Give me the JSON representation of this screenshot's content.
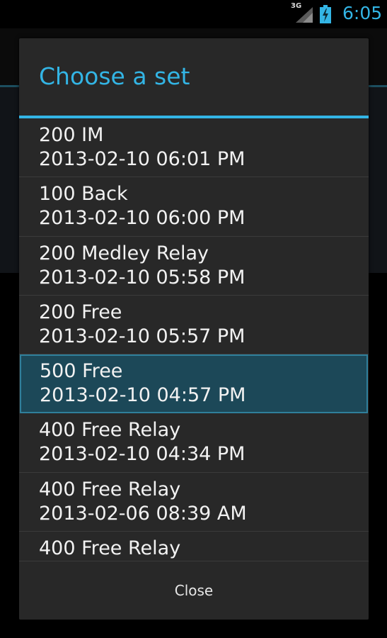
{
  "status_bar": {
    "network": "3G",
    "time": "6:05",
    "accent_color": "#33b5e5"
  },
  "dialog": {
    "title": "Choose a set",
    "items": [
      {
        "name": "200 IM",
        "date": "2013-02-10 06:01 PM",
        "selected": false
      },
      {
        "name": "100 Back",
        "date": "2013-02-10 06:00 PM",
        "selected": false
      },
      {
        "name": "200 Medley Relay",
        "date": "2013-02-10 05:58 PM",
        "selected": false
      },
      {
        "name": "200 Free",
        "date": "2013-02-10 05:57 PM",
        "selected": false
      },
      {
        "name": "500 Free",
        "date": "2013-02-10 04:57 PM",
        "selected": true
      },
      {
        "name": "400 Free Relay",
        "date": "2013-02-10 04:34 PM",
        "selected": false
      },
      {
        "name": "400 Free Relay",
        "date": "2013-02-06 08:39 AM",
        "selected": false
      },
      {
        "name": "400 Free Relay",
        "date": "",
        "selected": false
      }
    ],
    "close_label": "Close"
  }
}
